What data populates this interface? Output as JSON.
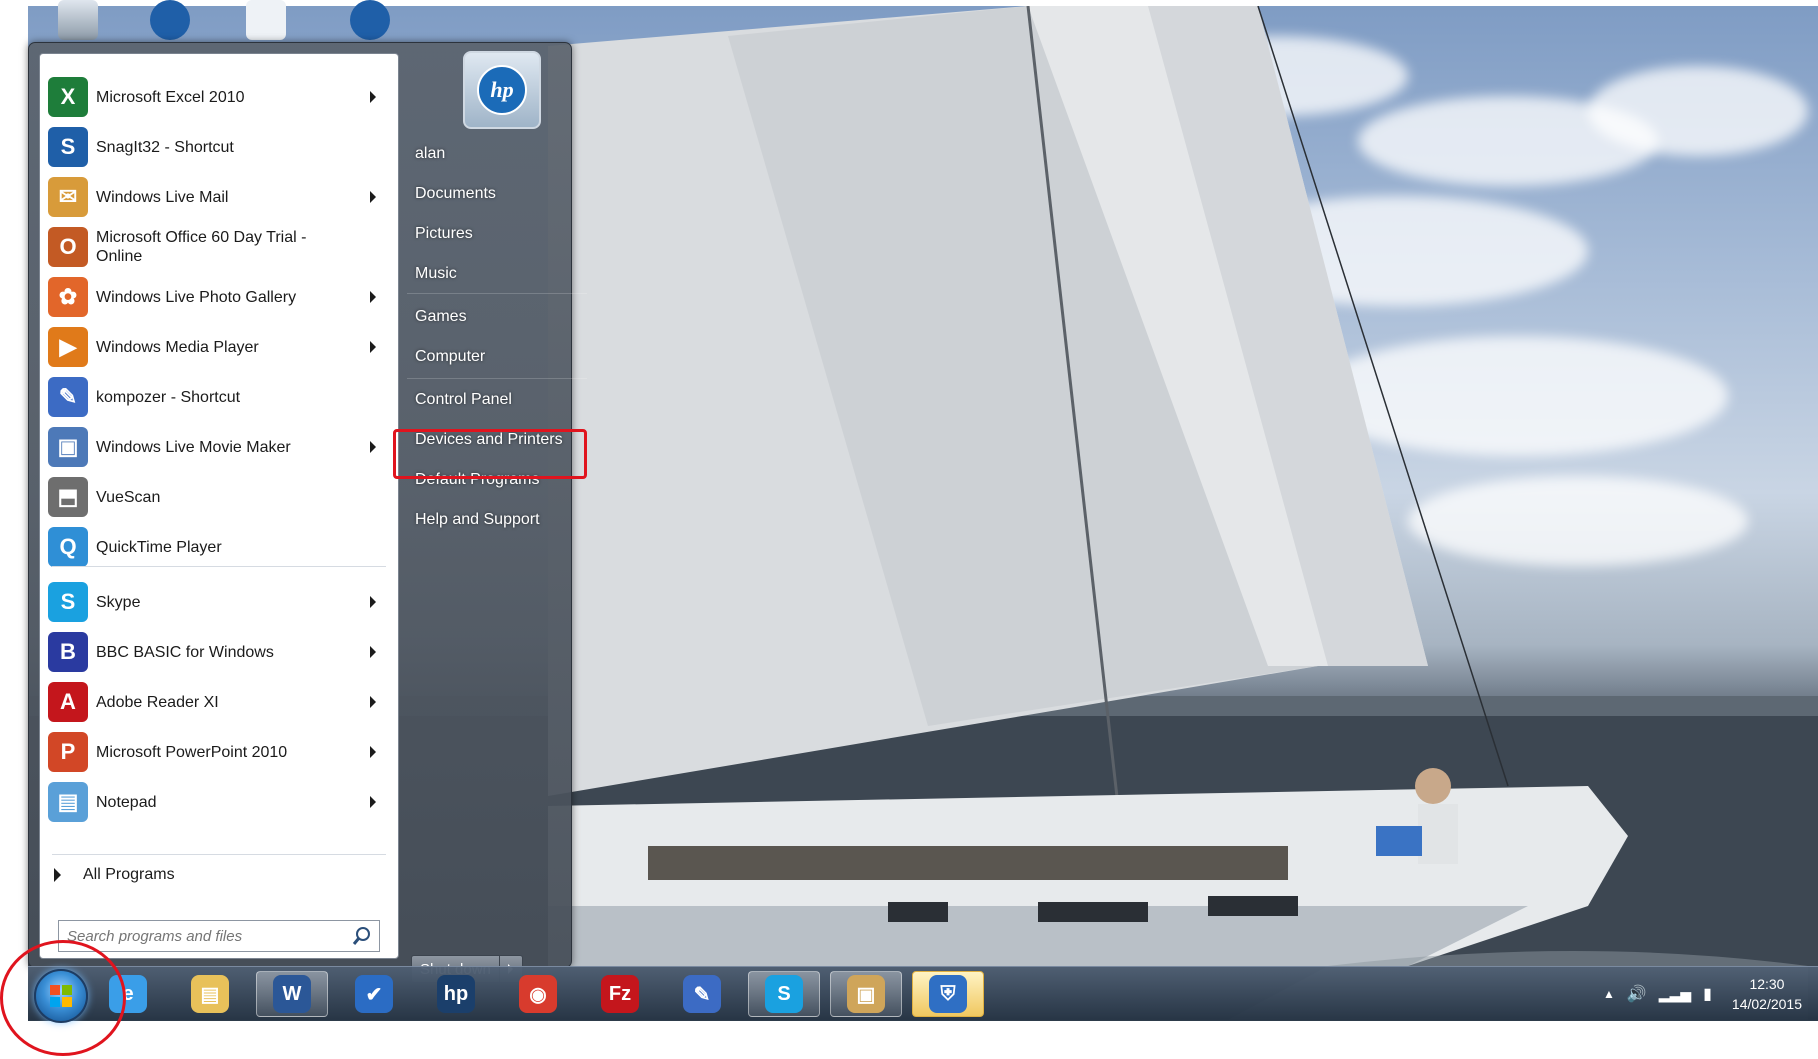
{
  "start_menu": {
    "programs": [
      {
        "label": "Microsoft Excel 2010",
        "icon": "excel-icon",
        "color": "#1e7d3a",
        "glyph": "X",
        "has_submenu": true
      },
      {
        "label": "SnagIt32 - Shortcut",
        "icon": "snagit-icon",
        "color": "#1f5fa8",
        "glyph": "S",
        "has_submenu": false
      },
      {
        "label": "Windows Live Mail",
        "icon": "mail-icon",
        "color": "#d89b3a",
        "glyph": "✉",
        "has_submenu": true
      },
      {
        "label": "Microsoft Office 60 Day Trial - Online",
        "icon": "office-icon",
        "color": "#c35a24",
        "glyph": "O",
        "has_submenu": false
      },
      {
        "label": "Windows Live Photo Gallery",
        "icon": "photo-gallery-icon",
        "color": "#e2662a",
        "glyph": "✿",
        "has_submenu": true
      },
      {
        "label": "Windows Media Player",
        "icon": "media-player-icon",
        "color": "#e07a1a",
        "glyph": "▶",
        "has_submenu": true
      },
      {
        "label": "kompozer - Shortcut",
        "icon": "kompozer-icon",
        "color": "#3c6bc4",
        "glyph": "✎",
        "has_submenu": false
      },
      {
        "label": "Windows Live Movie Maker",
        "icon": "movie-maker-icon",
        "color": "#4d79b8",
        "glyph": "▣",
        "has_submenu": true
      },
      {
        "label": "VueScan",
        "icon": "vuescan-icon",
        "color": "#6e6e6e",
        "glyph": "⬒",
        "has_submenu": false
      },
      {
        "label": "QuickTime Player",
        "icon": "quicktime-icon",
        "color": "#2f8fd6",
        "glyph": "Q",
        "has_submenu": false
      },
      {
        "label": "Skype",
        "icon": "skype-icon",
        "color": "#1aa1e0",
        "glyph": "S",
        "has_submenu": true
      },
      {
        "label": "BBC BASIC for Windows",
        "icon": "bbc-basic-icon",
        "color": "#2a3aa0",
        "glyph": "B",
        "has_submenu": true
      },
      {
        "label": "Adobe Reader XI",
        "icon": "adobe-reader-icon",
        "color": "#c4161c",
        "glyph": "A",
        "has_submenu": true
      },
      {
        "label": "Microsoft PowerPoint 2010",
        "icon": "powerpoint-icon",
        "color": "#d24726",
        "glyph": "P",
        "has_submenu": true
      },
      {
        "label": "Notepad",
        "icon": "notepad-icon",
        "color": "#5aa0d8",
        "glyph": "▤",
        "has_submenu": true
      }
    ],
    "all_programs": "All Programs",
    "search_placeholder": "Search programs and files",
    "right_links": [
      "alan",
      "Documents",
      "Pictures",
      "Music",
      "Games",
      "Computer",
      "Control Panel",
      "Devices and Printers",
      "Default Programs",
      "Help and Support"
    ],
    "shutdown_label": "Shut down",
    "highlighted_link": "Control Panel"
  },
  "taskbar": {
    "buttons": [
      "internet-explorer-icon",
      "windows-explorer-icon",
      "word-icon",
      "task-icon",
      "hp-icon",
      "chrome-icon",
      "filezilla-icon",
      "kompozer-icon",
      "skype-icon",
      "picture-viewer-icon",
      "security-shield-icon"
    ],
    "time": "12:30",
    "date": "14/02/2015"
  },
  "colors": {
    "highlight": "#e0141e",
    "taskbar": "#2a3a4e"
  }
}
